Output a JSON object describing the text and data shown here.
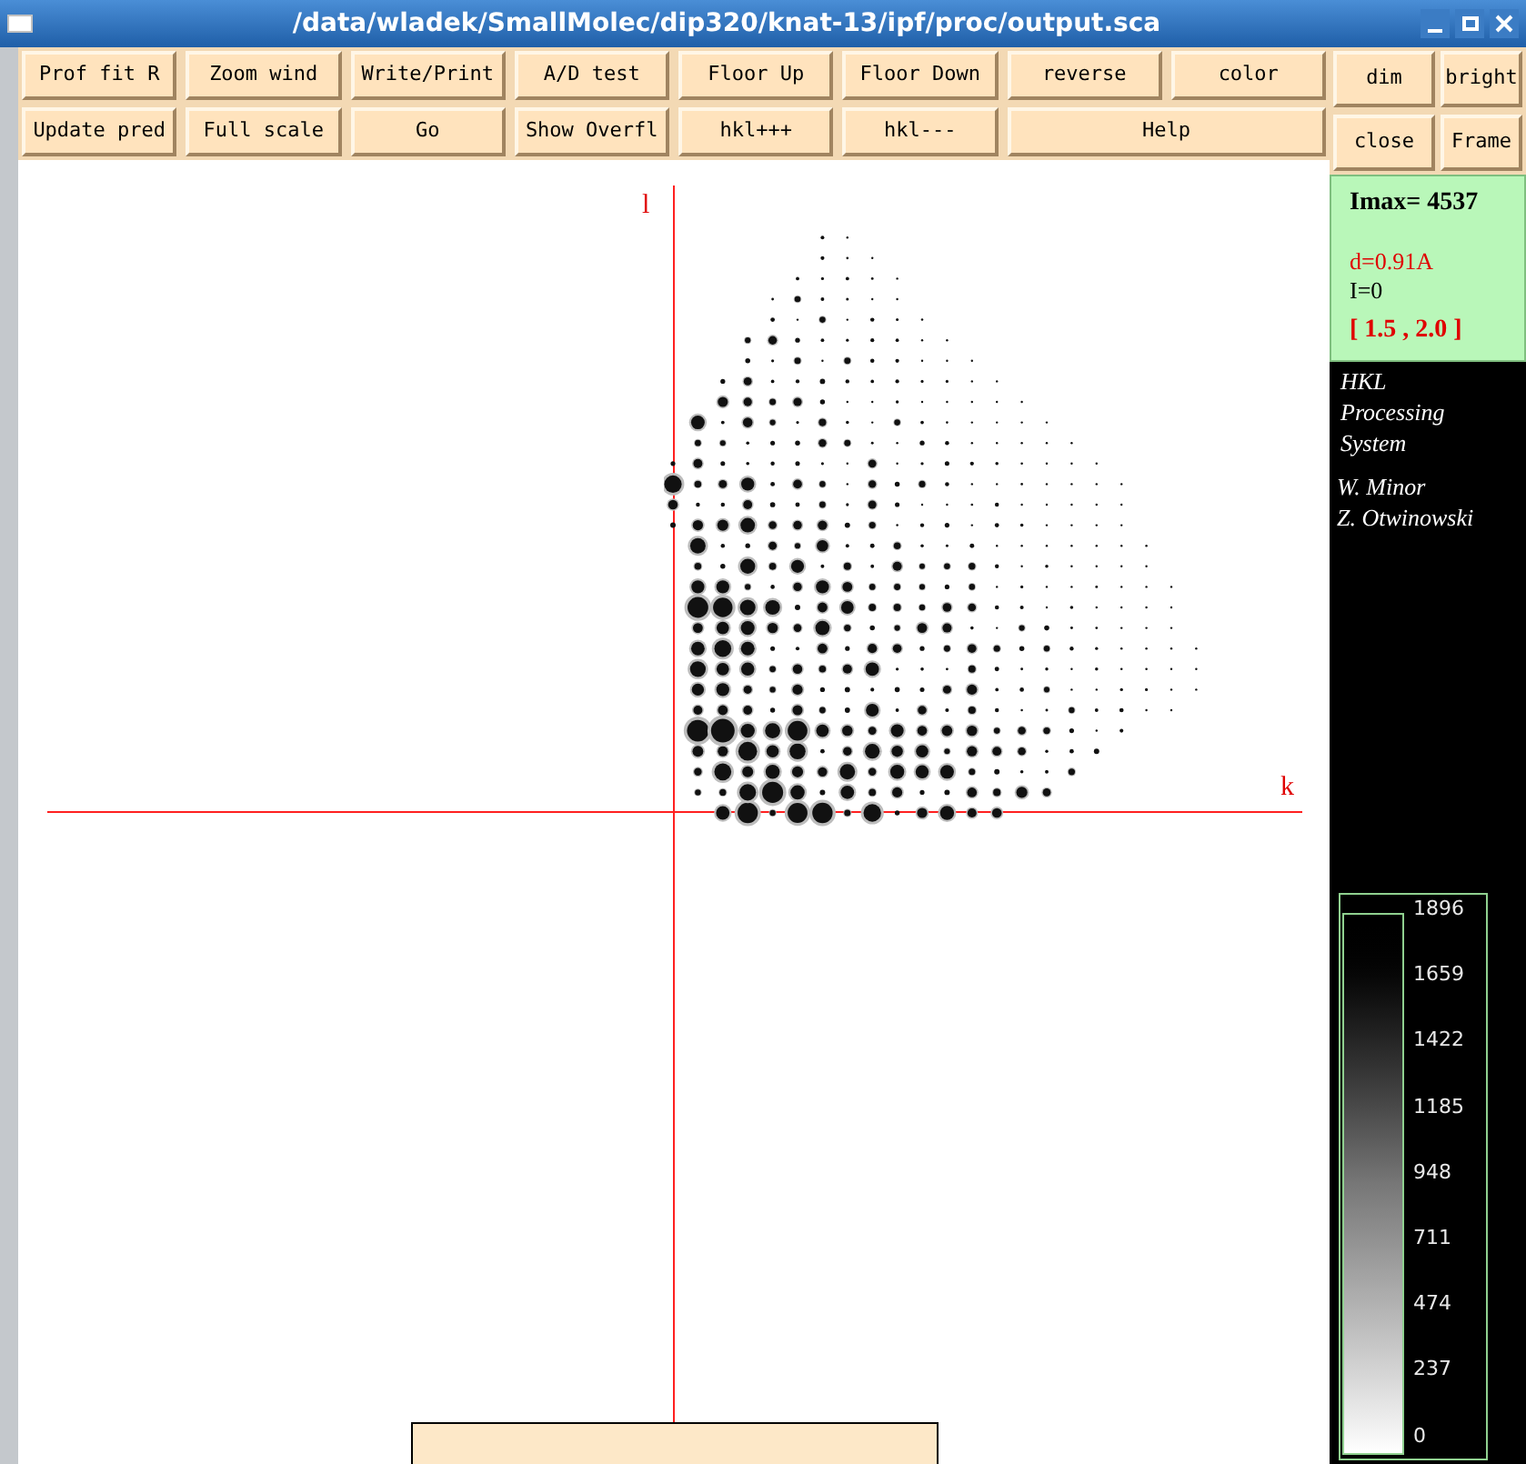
{
  "window": {
    "title": "/data/wladek/SmallMolec/dip320/knat-13/ipf/proc/output.sca"
  },
  "toolbar": {
    "rows": [
      [
        "Prof fit R",
        "Zoom wind",
        "Write/Print",
        "A/D test",
        "Floor Up",
        "Floor Down",
        "reverse",
        "color"
      ],
      [
        "Update pred",
        "Full scale",
        "Go",
        "Show Overfl",
        "hkl+++",
        "hkl---",
        "Help"
      ]
    ]
  },
  "side_buttons": {
    "rows": [
      [
        "dim",
        "bright"
      ],
      [
        "close",
        "Frame"
      ]
    ]
  },
  "plot": {
    "vertical_axis_label": "l",
    "horizontal_axis_label": "k"
  },
  "info": {
    "imax": "Imax= 4537",
    "resolution": "d=0.91A",
    "intensity": "I=0",
    "range": "[ 1.5 , 2.0 ]"
  },
  "credits": {
    "product": [
      "HKL",
      "Processing",
      "System"
    ],
    "authors": [
      "W. Minor",
      "Z. Otwinowski"
    ]
  },
  "scale": {
    "labels": [
      "1896",
      "1659",
      "1422",
      "1185",
      "948",
      "711",
      "474",
      "237",
      "0"
    ]
  }
}
